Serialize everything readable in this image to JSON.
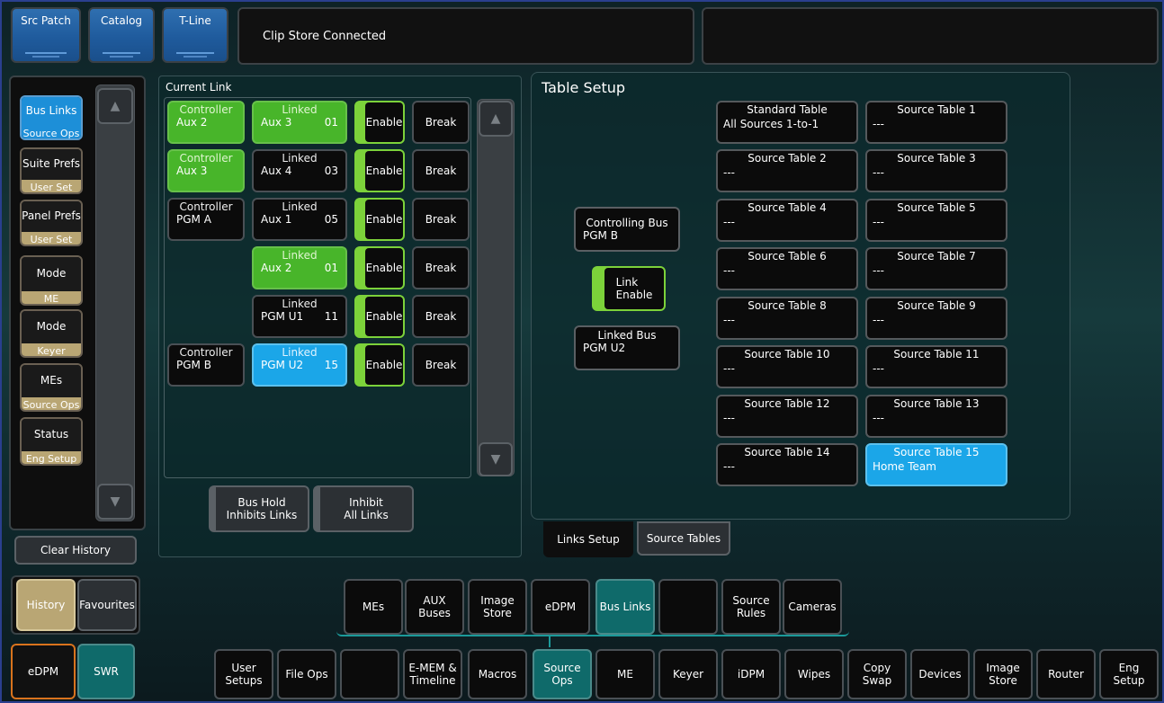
{
  "top_tabs": [
    {
      "label": "Src Patch"
    },
    {
      "label": "Catalog"
    },
    {
      "label": "T-Line"
    }
  ],
  "status_message": "Clip Store Connected",
  "sidebar": {
    "items": [
      {
        "label": "Bus Links",
        "sub": "Source Ops",
        "active": true
      },
      {
        "label": "Suite Prefs",
        "sub": "User Set"
      },
      {
        "label": "Panel Prefs",
        "sub": "User Set"
      },
      {
        "label": "Mode",
        "sub": "ME"
      },
      {
        "label": "Mode",
        "sub": "Keyer"
      },
      {
        "label": "MEs",
        "sub": "Source Ops"
      },
      {
        "label": "Status",
        "sub": "Eng Setup"
      }
    ],
    "clear_history": "Clear History",
    "history": "History",
    "favourites": "Favourites"
  },
  "current_link": {
    "title": "Current Link",
    "rows": [
      {
        "controller_label": "Controller",
        "controller_bus": "Aux 2",
        "controller_color": "green",
        "linked_label": "Linked",
        "linked_bus": "Aux 3",
        "linked_num": "01",
        "linked_color": "green",
        "enable": "Enable",
        "break": "Break"
      },
      {
        "controller_label": "Controller",
        "controller_bus": "Aux 3",
        "controller_color": "green",
        "linked_label": "Linked",
        "linked_bus": "Aux 4",
        "linked_num": "03",
        "linked_color": "black",
        "enable": "Enable",
        "break": "Break"
      },
      {
        "controller_label": "Controller",
        "controller_bus": "PGM A",
        "controller_color": "black",
        "linked_label": "Linked",
        "linked_bus": "Aux 1",
        "linked_num": "05",
        "linked_color": "black",
        "enable": "Enable",
        "break": "Break"
      },
      {
        "controller_label": "",
        "controller_bus": "",
        "controller_color": "none",
        "linked_label": "Linked",
        "linked_bus": "Aux 2",
        "linked_num": "01",
        "linked_color": "green",
        "enable": "Enable",
        "break": "Break"
      },
      {
        "controller_label": "",
        "controller_bus": "",
        "controller_color": "none",
        "linked_label": "Linked",
        "linked_bus": "PGM U1",
        "linked_num": "11",
        "linked_color": "black",
        "enable": "Enable",
        "break": "Break"
      },
      {
        "controller_label": "Controller",
        "controller_bus": "PGM B",
        "controller_color": "black",
        "linked_label": "Linked",
        "linked_bus": "PGM U2",
        "linked_num": "15",
        "linked_color": "blue",
        "enable": "Enable",
        "break": "Break"
      }
    ],
    "bus_hold": "Bus Hold\nInhibits Links",
    "inhibit_all": "Inhibit\nAll Links"
  },
  "table_setup": {
    "title": "Table Setup",
    "controlling_bus_label": "Controlling Bus",
    "controlling_bus_value": "PGM B",
    "link_enable": "Link\nEnable",
    "linked_bus_label": "Linked Bus",
    "linked_bus_value": "PGM U2",
    "tables": [
      {
        "title": "Standard Table",
        "value": "All Sources 1-to-1"
      },
      {
        "title": "Source Table 1",
        "value": "---"
      },
      {
        "title": "Source Table 2",
        "value": "---"
      },
      {
        "title": "Source Table 3",
        "value": "---"
      },
      {
        "title": "Source Table 4",
        "value": "---"
      },
      {
        "title": "Source Table 5",
        "value": "---"
      },
      {
        "title": "Source Table 6",
        "value": "---"
      },
      {
        "title": "Source Table 7",
        "value": "---"
      },
      {
        "title": "Source Table 8",
        "value": "---"
      },
      {
        "title": "Source Table 9",
        "value": "---"
      },
      {
        "title": "Source Table 10",
        "value": "---"
      },
      {
        "title": "Source Table 11",
        "value": "---"
      },
      {
        "title": "Source Table 12",
        "value": "---"
      },
      {
        "title": "Source Table 13",
        "value": "---"
      },
      {
        "title": "Source Table 14",
        "value": "---"
      },
      {
        "title": "Source Table 15",
        "value": "Home Team",
        "selected": true
      }
    ],
    "tabs": [
      "Links Setup",
      "Source Tables"
    ]
  },
  "mid_menu": [
    "MEs",
    "AUX\nBuses",
    "Image\nStore",
    "eDPM",
    "Bus Links",
    "",
    "Source\nRules",
    "Cameras"
  ],
  "bottom": {
    "edpm": "eDPM",
    "swr": "SWR",
    "menu": [
      "User\nSetups",
      "File Ops",
      "",
      "E-MEM &\nTimeline",
      "Macros",
      "Source\nOps",
      "ME",
      "Keyer",
      "iDPM",
      "Wipes",
      "Copy\nSwap",
      "Devices",
      "Image\nStore",
      "Router",
      "Eng\nSetup"
    ]
  },
  "colors": {
    "green": "#48b52a",
    "blue": "#1ba6e8",
    "teal": "#0f6a6a",
    "enable_green": "#7cd23a",
    "tan": "#b9a674"
  }
}
